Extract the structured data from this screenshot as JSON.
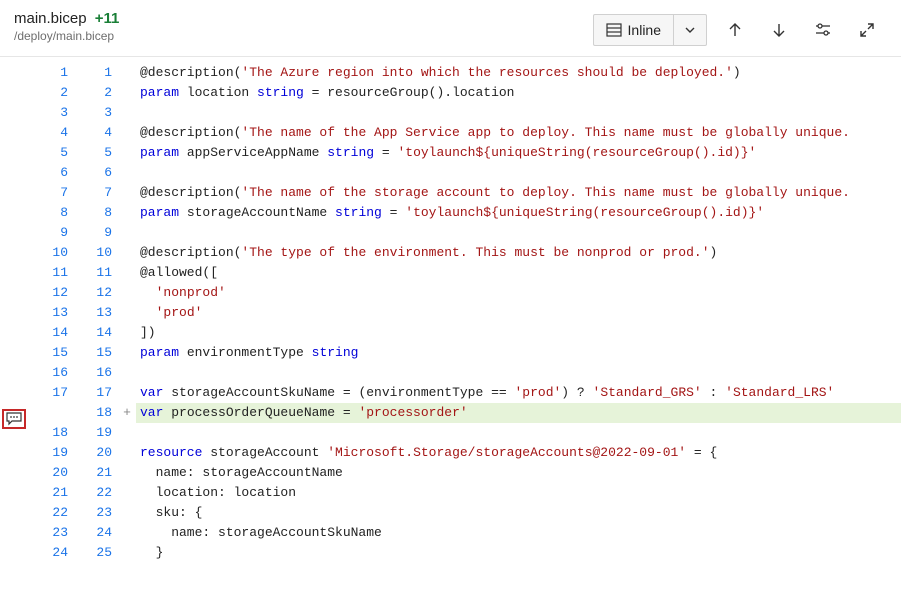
{
  "header": {
    "file_name": "main.bicep",
    "added_count": "+11",
    "file_path": "/deploy/main.bicep",
    "inline_label": "Inline"
  },
  "gutter": {
    "left": [
      "1",
      "2",
      "3",
      "4",
      "5",
      "6",
      "7",
      "8",
      "9",
      "10",
      "11",
      "12",
      "13",
      "14",
      "15",
      "16",
      "17",
      "",
      "18",
      "19",
      "20",
      "21",
      "22",
      "23",
      "24"
    ],
    "right": [
      "1",
      "2",
      "3",
      "4",
      "5",
      "6",
      "7",
      "8",
      "9",
      "10",
      "11",
      "12",
      "13",
      "14",
      "15",
      "16",
      "17",
      "18",
      "19",
      "20",
      "21",
      "22",
      "23",
      "24",
      "25"
    ],
    "plus": [
      "",
      "",
      "",
      "",
      "",
      "",
      "",
      "",
      "",
      "",
      "",
      "",
      "",
      "",
      "",
      "",
      "",
      "+",
      "",
      "",
      "",
      "",
      "",
      "",
      ""
    ]
  },
  "highlight_comment_row": 17,
  "code": [
    {
      "t": [
        [
          "dec",
          "@description("
        ],
        [
          "str",
          "'The Azure region into which the resources should be deployed.'"
        ],
        [
          "dec",
          ")"
        ]
      ]
    },
    {
      "t": [
        [
          "kw",
          "param "
        ],
        [
          "id",
          "location "
        ],
        [
          "kw",
          "string"
        ],
        [
          "id",
          " = resourceGroup().location"
        ]
      ]
    },
    {
      "t": []
    },
    {
      "t": [
        [
          "dec",
          "@description("
        ],
        [
          "str",
          "'The name of the App Service app to deploy. This name must be globally unique."
        ]
      ]
    },
    {
      "t": [
        [
          "kw",
          "param "
        ],
        [
          "id",
          "appServiceAppName "
        ],
        [
          "kw",
          "string"
        ],
        [
          "id",
          " = "
        ],
        [
          "str",
          "'toylaunch${uniqueString(resourceGroup().id)}'"
        ]
      ]
    },
    {
      "t": []
    },
    {
      "t": [
        [
          "dec",
          "@description("
        ],
        [
          "str",
          "'The name of the storage account to deploy. This name must be globally unique."
        ]
      ]
    },
    {
      "t": [
        [
          "kw",
          "param "
        ],
        [
          "id",
          "storageAccountName "
        ],
        [
          "kw",
          "string"
        ],
        [
          "id",
          " = "
        ],
        [
          "str",
          "'toylaunch${uniqueString(resourceGroup().id)}'"
        ]
      ]
    },
    {
      "t": []
    },
    {
      "t": [
        [
          "dec",
          "@description("
        ],
        [
          "str",
          "'The type of the environment. This must be nonprod or prod.'"
        ],
        [
          "dec",
          ")"
        ]
      ]
    },
    {
      "t": [
        [
          "dec",
          "@allowed(["
        ]
      ]
    },
    {
      "t": [
        [
          "id",
          "  "
        ],
        [
          "str",
          "'nonprod'"
        ]
      ]
    },
    {
      "t": [
        [
          "id",
          "  "
        ],
        [
          "str",
          "'prod'"
        ]
      ]
    },
    {
      "t": [
        [
          "dec",
          "])"
        ]
      ]
    },
    {
      "t": [
        [
          "kw",
          "param "
        ],
        [
          "id",
          "environmentType "
        ],
        [
          "kw",
          "string"
        ]
      ]
    },
    {
      "t": []
    },
    {
      "t": [
        [
          "kw",
          "var "
        ],
        [
          "id",
          "storageAccountSkuName = (environmentType == "
        ],
        [
          "str",
          "'prod'"
        ],
        [
          "id",
          ") ? "
        ],
        [
          "str",
          "'Standard_GRS'"
        ],
        [
          "id",
          " : "
        ],
        [
          "str",
          "'Standard_LRS'"
        ]
      ]
    },
    {
      "added": true,
      "t": [
        [
          "kw",
          "var "
        ],
        [
          "id",
          "processOrderQueueName = "
        ],
        [
          "str",
          "'processorder'"
        ]
      ]
    },
    {
      "t": []
    },
    {
      "t": [
        [
          "kw",
          "resource "
        ],
        [
          "id",
          "storageAccount "
        ],
        [
          "str",
          "'Microsoft.Storage/storageAccounts@2022-09-01'"
        ],
        [
          "id",
          " = {"
        ]
      ]
    },
    {
      "t": [
        [
          "id",
          "  name: storageAccountName"
        ]
      ]
    },
    {
      "t": [
        [
          "id",
          "  location: location"
        ]
      ]
    },
    {
      "t": [
        [
          "id",
          "  sku: {"
        ]
      ]
    },
    {
      "t": [
        [
          "id",
          "    name: storageAccountSkuName"
        ]
      ]
    },
    {
      "t": [
        [
          "id",
          "  }"
        ]
      ]
    }
  ]
}
